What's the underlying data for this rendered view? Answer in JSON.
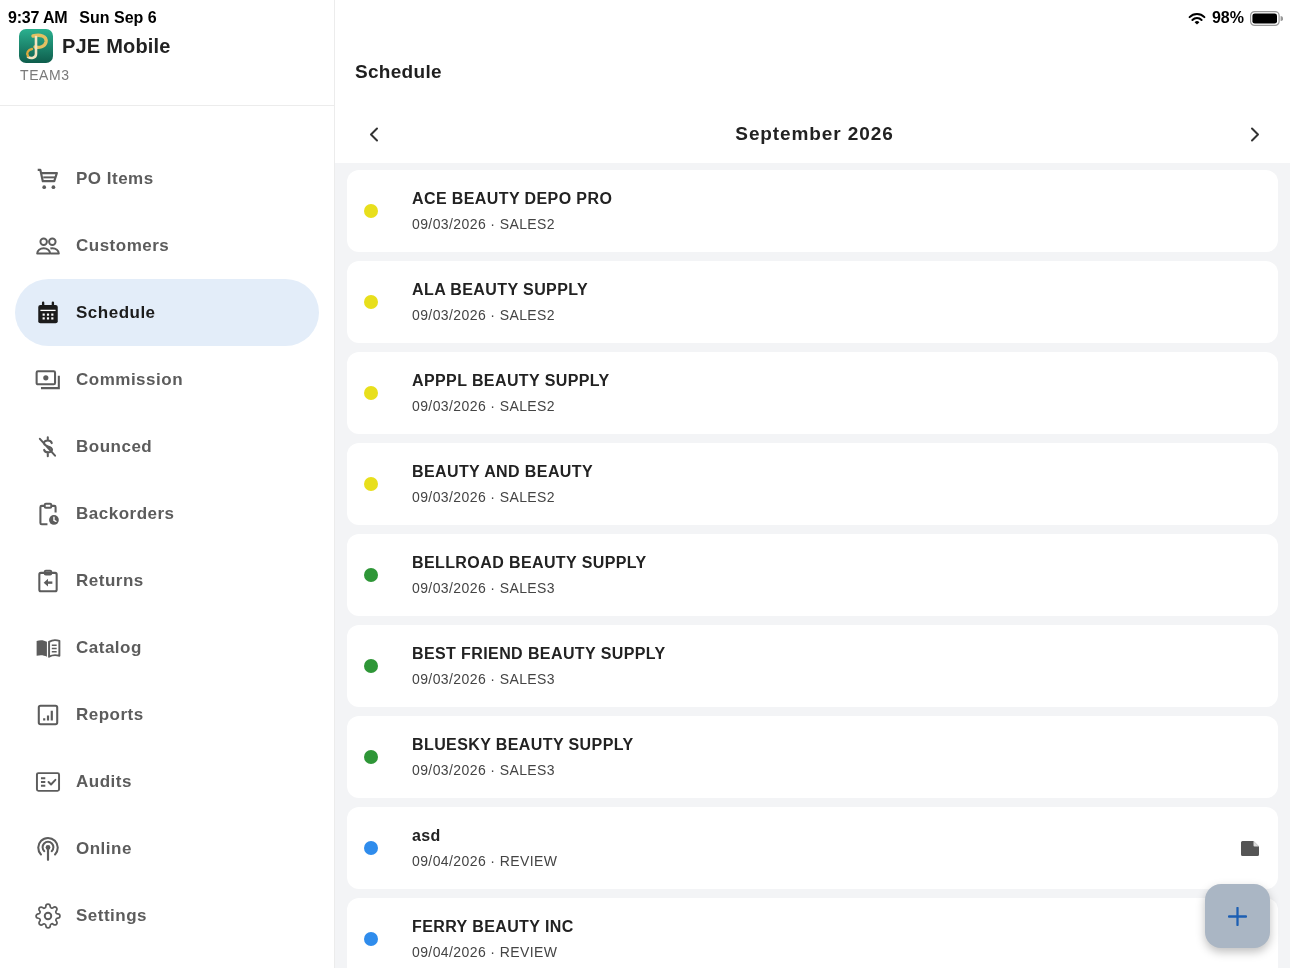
{
  "status_bar": {
    "time": "9:37 AM",
    "date": "Sun Sep 6",
    "battery": "98%"
  },
  "sidebar": {
    "app_name": "PJE Mobile",
    "team": "TEAM3",
    "items": [
      {
        "label": "PO Items",
        "selected": false
      },
      {
        "label": "Customers",
        "selected": false
      },
      {
        "label": "Schedule",
        "selected": true
      },
      {
        "label": "Commission",
        "selected": false
      },
      {
        "label": "Bounced",
        "selected": false
      },
      {
        "label": "Backorders",
        "selected": false
      },
      {
        "label": "Returns",
        "selected": false
      },
      {
        "label": "Catalog",
        "selected": false
      },
      {
        "label": "Reports",
        "selected": false
      },
      {
        "label": "Audits",
        "selected": false
      },
      {
        "label": "Online",
        "selected": false
      },
      {
        "label": "Settings",
        "selected": false
      }
    ]
  },
  "header": {
    "title": "Schedule"
  },
  "month_nav": {
    "title": "September 2026"
  },
  "events": [
    {
      "title": "ACE BEAUTY DEPO PRO",
      "subtitle": "09/03/2026 · SALES2",
      "color": "#e8df1c",
      "has_document": false
    },
    {
      "title": "ALA BEAUTY SUPPLY",
      "subtitle": "09/03/2026 · SALES2",
      "color": "#e8df1c",
      "has_document": false
    },
    {
      "title": "APPPL BEAUTY SUPPLY",
      "subtitle": "09/03/2026 · SALES2",
      "color": "#e8df1c",
      "has_document": false
    },
    {
      "title": "BEAUTY AND BEAUTY",
      "subtitle": "09/03/2026 · SALES2",
      "color": "#e8df1c",
      "has_document": false
    },
    {
      "title": "BELLROAD BEAUTY SUPPLY",
      "subtitle": "09/03/2026 · SALES3",
      "color": "#2e9637",
      "has_document": false
    },
    {
      "title": "BEST FRIEND BEAUTY SUPPLY",
      "subtitle": "09/03/2026 · SALES3",
      "color": "#2e9637",
      "has_document": false
    },
    {
      "title": "BLUESKY BEAUTY SUPPLY",
      "subtitle": "09/03/2026 · SALES3",
      "color": "#2e9637",
      "has_document": false
    },
    {
      "title": "asd",
      "subtitle": "09/04/2026 · REVIEW",
      "color": "#2f8cec",
      "has_document": true
    },
    {
      "title": "FERRY BEAUTY INC",
      "subtitle": "09/04/2026 · REVIEW",
      "color": "#2f8cec",
      "has_document": false
    }
  ]
}
